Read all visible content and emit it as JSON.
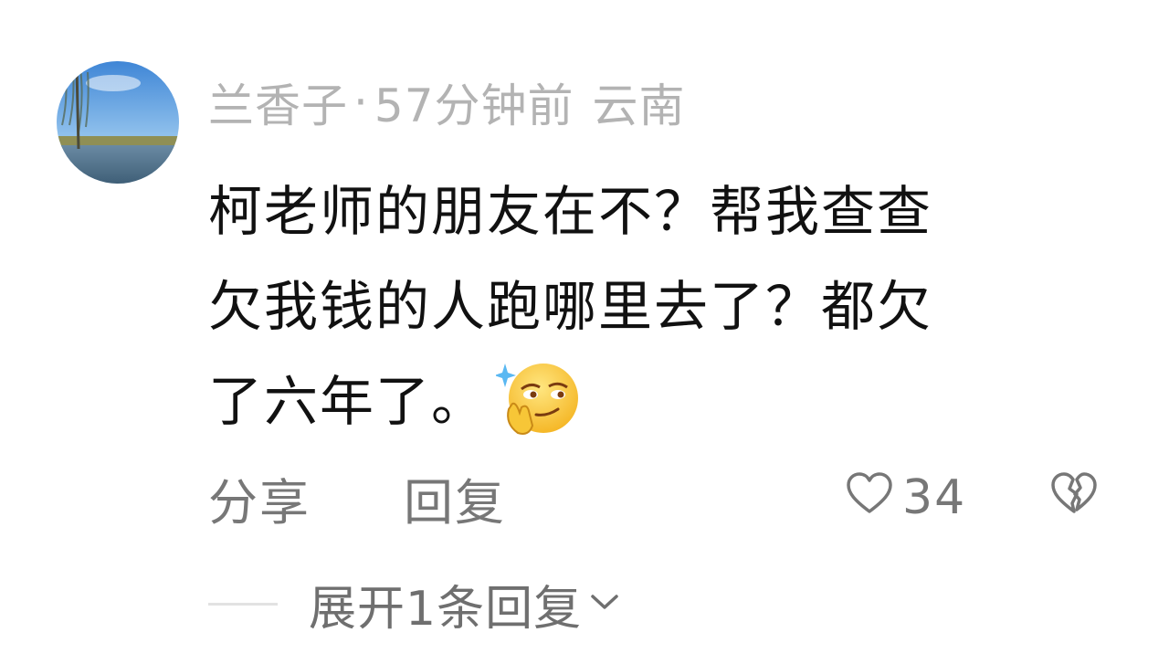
{
  "comment": {
    "username": "兰香子",
    "separator": "·",
    "time": "57分钟前",
    "location": "云南",
    "text_lines": [
      "柯老师的朋友在不？帮我查查",
      "欠我钱的人跑哪里去了？都欠",
      "了六年了。"
    ],
    "emoji": "smirk-emoji"
  },
  "actions": {
    "share_label": "分享",
    "reply_label": "回复",
    "like_count": "34"
  },
  "replies": {
    "expand_label": "展开1条回复"
  },
  "icons": {
    "like": "heart-outline-icon",
    "dislike": "broken-heart-icon",
    "expand": "chevron-down-icon"
  }
}
